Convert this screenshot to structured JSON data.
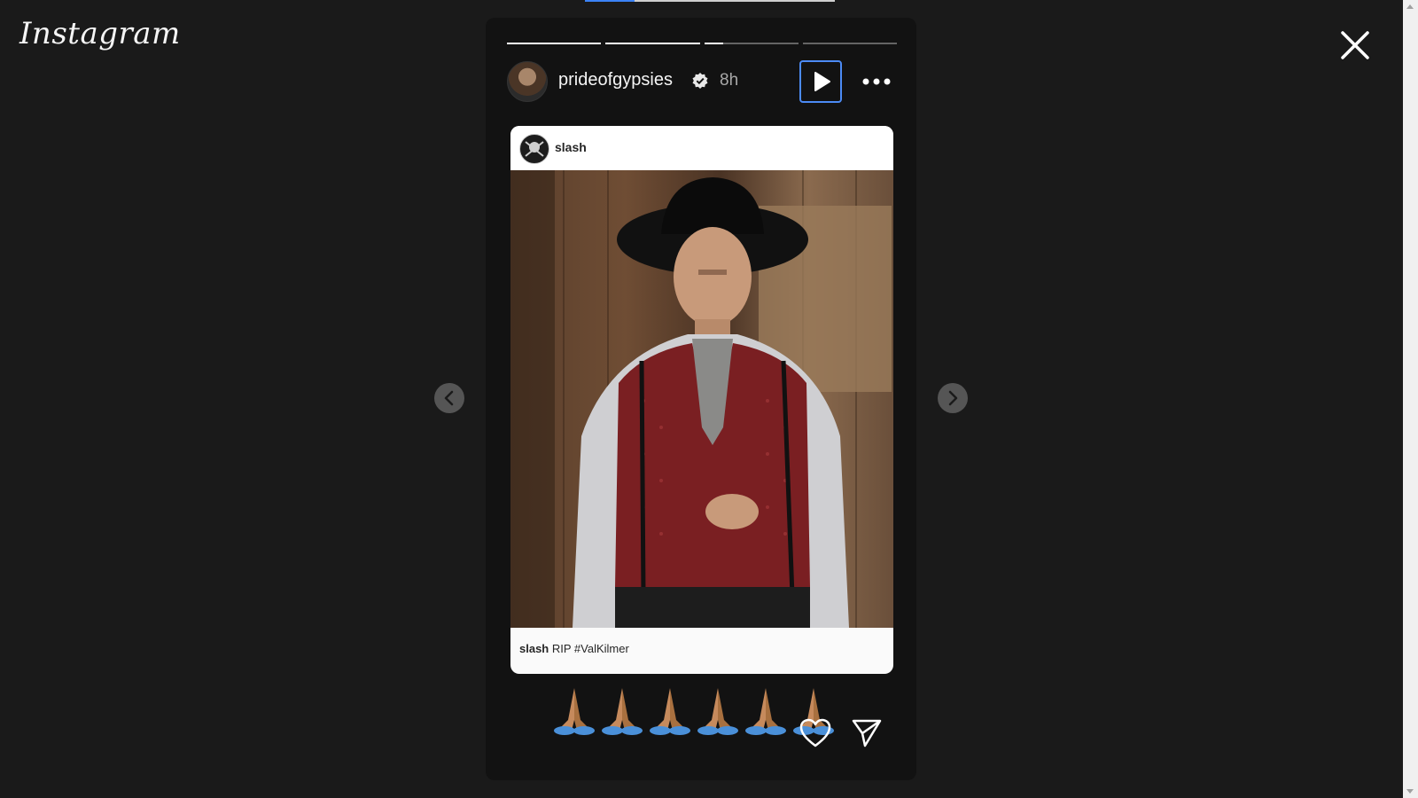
{
  "app": {
    "logo_text": "Instagram"
  },
  "story": {
    "username": "prideofgypsies",
    "timestamp": "8h",
    "progress_segments": [
      1.0,
      1.0,
      0.2,
      0.0
    ]
  },
  "post": {
    "username": "slash",
    "caption_user": "slash",
    "caption_text": "RIP #ValKilmer"
  },
  "reactions": {
    "emoji": "🙏",
    "count": 6
  },
  "icons": {
    "close": "close-icon",
    "verified": "verified-badge-icon",
    "play": "play-icon",
    "more": "more-options-icon",
    "prev": "chevron-left-icon",
    "next": "chevron-right-icon",
    "like": "heart-icon",
    "share": "send-icon"
  },
  "colors": {
    "accent": "#4c8bf5",
    "background": "#1a1a1a",
    "story_bg": "#121212"
  }
}
